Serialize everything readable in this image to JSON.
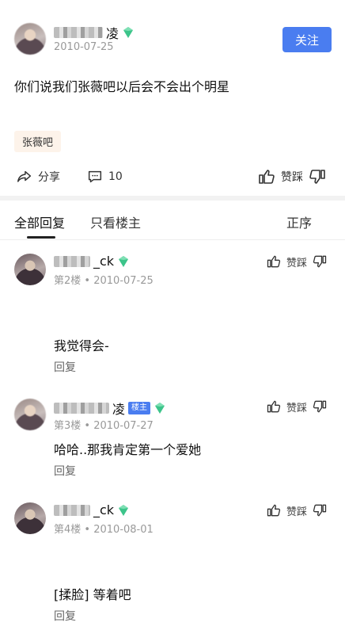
{
  "post": {
    "author_suffix": "凌",
    "date": "2010-07-25",
    "follow_label": "关注",
    "content": "你们说我们张薇吧以后会不会出个明星",
    "tag": "张薇吧",
    "share_label": "分享",
    "comment_count": "10",
    "vote_label": "赞踩"
  },
  "tabs": {
    "all_replies": "全部回复",
    "only_op": "只看楼主",
    "sort": "正序"
  },
  "replies": [
    {
      "name_suffix": "_ck",
      "floor": "第2楼",
      "date": "2010-07-25",
      "content": "我觉得会-",
      "reply_label": "回复",
      "vote_label": "赞踩"
    },
    {
      "name_suffix": "凌",
      "op_badge": "楼主",
      "floor": "第3楼",
      "date": "2010-07-27",
      "content": "哈哈..那我肯定第一个爱她",
      "reply_label": "回复",
      "vote_label": "赞踩"
    },
    {
      "name_suffix": "_ck",
      "floor": "第4楼",
      "date": "2010-08-01",
      "content": "[揉脸] 等着吧",
      "reply_label": "回复",
      "vote_label": "赞踩"
    }
  ],
  "icons": {
    "gem": "diamond-badge-icon",
    "share": "share-icon",
    "comment": "comment-icon",
    "thumb_up": "thumb-up-icon",
    "thumb_down": "thumb-down-icon"
  },
  "colors": {
    "accent": "#4a7df0",
    "gem": "#3cc48a"
  }
}
